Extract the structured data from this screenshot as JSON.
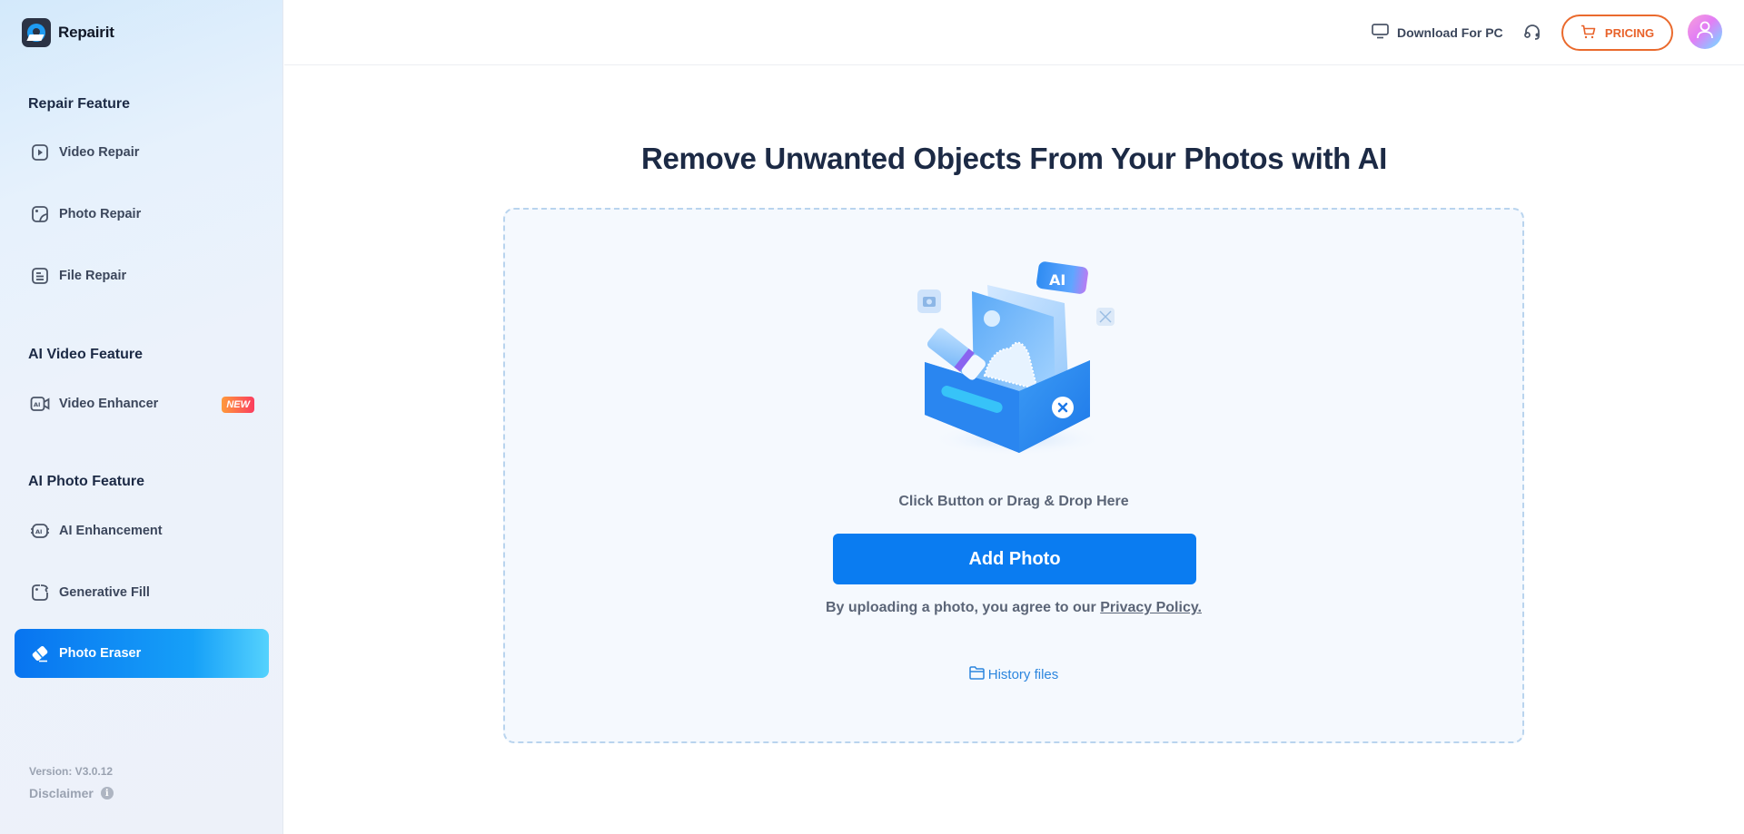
{
  "app": {
    "name": "Repairit"
  },
  "sidebar": {
    "sections": [
      {
        "title": "Repair Feature",
        "items": [
          {
            "label": "Video Repair",
            "icon": "video-play-icon"
          },
          {
            "label": "Photo Repair",
            "icon": "photo-icon"
          },
          {
            "label": "File Repair",
            "icon": "document-icon"
          }
        ]
      },
      {
        "title": "AI Video Feature",
        "items": [
          {
            "label": "Video Enhancer",
            "icon": "ai-video-icon",
            "badge": "NEW"
          }
        ]
      },
      {
        "title": "AI Photo Feature",
        "items": [
          {
            "label": "AI Enhancement",
            "icon": "ai-chip-icon"
          },
          {
            "label": "Generative Fill",
            "icon": "generative-fill-icon"
          },
          {
            "label": "Photo Eraser",
            "icon": "eraser-icon",
            "active": true
          }
        ]
      }
    ],
    "version": "Version: V3.0.12",
    "disclaimer": "Disclaimer",
    "disclaimer_icon": "info-icon"
  },
  "header": {
    "download_label": "Download For PC",
    "download_icon": "monitor-icon",
    "support_icon": "headset-icon",
    "pricing_label": "PRICING",
    "pricing_icon": "cart-icon",
    "avatar_icon": "user-icon"
  },
  "main": {
    "title": "Remove Unwanted Objects From Your Photos with AI",
    "illustration": "upload-box-illustration",
    "illustration_badge": "AI",
    "hint": "Click Button or Drag & Drop Here",
    "add_button": "Add Photo",
    "agree_prefix": "By uploading a photo, you agree to our ",
    "privacy_link": "Privacy Policy.",
    "history_label": "History files",
    "history_icon": "folder-icon"
  },
  "colors": {
    "primary": "#0a7cf1",
    "pricing": "#e8622a",
    "title": "#1c2a45",
    "new_badge_start": "#ff9a3a",
    "new_badge_end": "#fb3d5f"
  }
}
